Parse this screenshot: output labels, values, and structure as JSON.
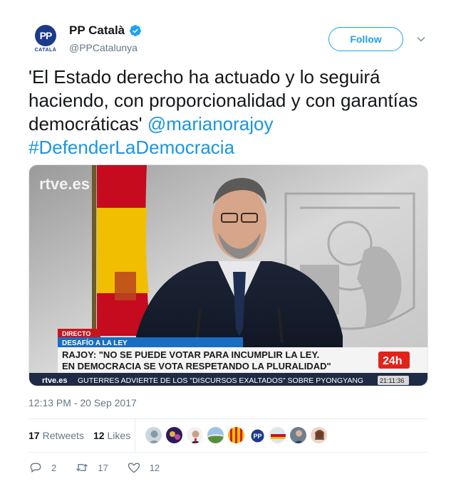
{
  "colors": {
    "accent": "#1da1f2",
    "link": "#1b95e0",
    "muted": "#657786",
    "text": "#14171a",
    "verified": "#1da1f2"
  },
  "user": {
    "display_name": "PP Català",
    "handle": "@PPCatalunya",
    "avatar_logo_text": "PP",
    "avatar_caption": "CATALÀ",
    "verified_icon": "verified-badge-icon"
  },
  "follow_label": "Follow",
  "tweet": {
    "text": "'El Estado derecho ha actuado y lo seguirá haciendo, con proporcionalidad y con garantías democráticas' ",
    "mention": "@marianorajoy",
    "hashtag": "#DefenderLaDemocracia"
  },
  "media": {
    "logo": "rtve.es",
    "tag_live": "DIRECTO",
    "tag_program": "DESAFÍO A LA LEY",
    "headline_1": "RAJOY: \"NO SE PUEDE VOTAR PARA INCUMPLIR LA LEY.",
    "headline_2": "EN DEMOCRACIA SE VOTA RESPETANDO LA PLURALIDAD\"",
    "channel_badge": "24h",
    "ticker_logo": "rtve.es",
    "ticker": "GUTERRES ADVIERTE DE LOS \"DISCURSOS EXALTADOS\" SOBRE PYONGYANG",
    "clock": "21:11:36"
  },
  "timestamp": "12:13 PM - 20 Sep 2017",
  "stats": {
    "retweets_count": "17",
    "retweets_label": "Retweets",
    "likes_count": "12",
    "likes_label": "Likes"
  },
  "actions": {
    "replies": "2",
    "retweets": "17",
    "likes": "12"
  }
}
